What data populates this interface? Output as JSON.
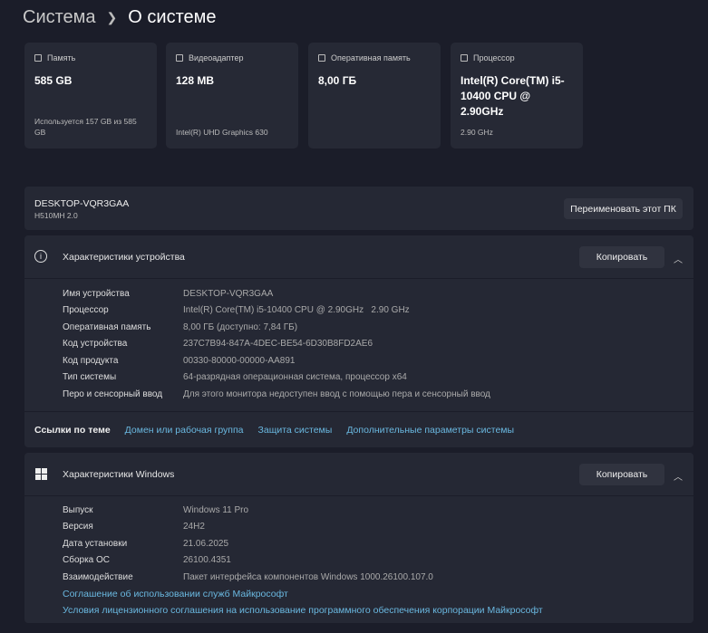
{
  "breadcrumb": {
    "parent": "Система",
    "current": "О системе"
  },
  "cards": [
    {
      "icon": "storage-icon",
      "label": "Память",
      "value": "585 GB",
      "sub": "Используется 157 GB из 585 GB"
    },
    {
      "icon": "display-adapter-icon",
      "label": "Видеоадаптер",
      "value": "128 MB",
      "sub": "Intel(R) UHD Graphics 630"
    },
    {
      "icon": "ram-icon",
      "label": "Оперативная память",
      "value": "8,00 ГБ",
      "sub": ""
    },
    {
      "icon": "cpu-icon",
      "label": "Процессор",
      "value": "Intel(R) Core(TM) i5-10400 CPU @ 2.90GHz",
      "sub": "2.90 GHz"
    }
  ],
  "device": {
    "name": "DESKTOP-VQR3GAA",
    "model": "H510MH 2.0",
    "rename": "Переименовать этот ПК"
  },
  "device_specs": {
    "title": "Характеристики устройства",
    "copy": "Копировать",
    "rows": [
      {
        "k": "Имя устройства",
        "v": "DESKTOP-VQR3GAA"
      },
      {
        "k": "Процессор",
        "v": "Intel(R) Core(TM) i5-10400 CPU @ 2.90GHz   2.90 GHz"
      },
      {
        "k": "Оперативная память",
        "v": "8,00 ГБ (доступно: 7,84 ГБ)"
      },
      {
        "k": "Код устройства",
        "v": "237C7B94-847A-4DEC-BE54-6D30B8FD2AE6"
      },
      {
        "k": "Код продукта",
        "v": "00330-80000-00000-AA891"
      },
      {
        "k": "Тип системы",
        "v": "64-разрядная операционная система, процессор x64"
      },
      {
        "k": "Перо и сенсорный ввод",
        "v": "Для этого монитора недоступен ввод с помощью пера и сенсорный ввод"
      }
    ]
  },
  "related": {
    "label": "Ссылки по теме",
    "links": [
      "Домен или рабочая группа",
      "Защита системы",
      "Дополнительные параметры системы"
    ]
  },
  "windows_specs": {
    "title": "Характеристики Windows",
    "copy": "Копировать",
    "rows": [
      {
        "k": "Выпуск",
        "v": "Windows 11 Pro"
      },
      {
        "k": "Версия",
        "v": "24H2"
      },
      {
        "k": "Дата установки",
        "v": "21.06.2025"
      },
      {
        "k": "Сборка ОС",
        "v": "26100.4351"
      },
      {
        "k": "Взаимодействие",
        "v": "Пакет интерфейса компонентов Windows 1000.26100.107.0"
      }
    ],
    "links": [
      "Соглашение об использовании служб Майкрософт",
      "Условия лицензионного соглашения на использование программного обеспечения корпорации Майкрософт"
    ]
  }
}
